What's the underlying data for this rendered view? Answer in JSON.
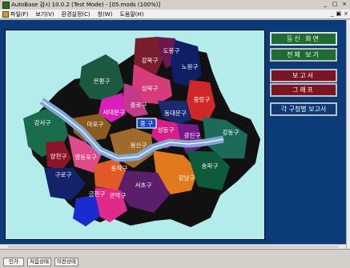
{
  "window": {
    "title": "AutoBase 감시 10.0.2 (Test Mode) - [05.mods (100%)]"
  },
  "menu": {
    "items": [
      "파일(F)",
      "보기(V)",
      "환경설정(C)",
      "창(W)",
      "도움말(H)"
    ],
    "mdi_controls": [
      "_",
      "▣",
      "×"
    ]
  },
  "window_controls": [
    "_",
    "□",
    "×"
  ],
  "map": {
    "center_label": "중 구",
    "districts": [
      {
        "id": "dobong",
        "name": "도봉구"
      },
      {
        "id": "gangbuk",
        "name": "강북구"
      },
      {
        "id": "nowon",
        "name": "노원구"
      },
      {
        "id": "eunpyeong",
        "name": "은평구"
      },
      {
        "id": "seongbuk",
        "name": "성북구"
      },
      {
        "id": "jungnang",
        "name": "중랑구"
      },
      {
        "id": "jongno",
        "name": "종로구"
      },
      {
        "id": "seodaemun",
        "name": "서대문구"
      },
      {
        "id": "dongdaemun",
        "name": "동대문구"
      },
      {
        "id": "mapo",
        "name": "마포구"
      },
      {
        "id": "seongdong",
        "name": "성동구"
      },
      {
        "id": "gwangjin",
        "name": "광진구"
      },
      {
        "id": "gangdong",
        "name": "강동구"
      },
      {
        "id": "gangseo",
        "name": "강서구"
      },
      {
        "id": "yangcheon",
        "name": "양천구"
      },
      {
        "id": "yeongdeungpo",
        "name": "영등포구"
      },
      {
        "id": "yongsan",
        "name": "용산구"
      },
      {
        "id": "dongjak",
        "name": "동작구"
      },
      {
        "id": "guro",
        "name": "구로구"
      },
      {
        "id": "gangnam",
        "name": "강남구"
      },
      {
        "id": "songpa",
        "name": "송파구"
      },
      {
        "id": "seocho",
        "name": "서초구"
      },
      {
        "id": "gwanak",
        "name": "관악구"
      },
      {
        "id": "geumcheon",
        "name": "금천구"
      }
    ]
  },
  "sidebar": {
    "buttons": [
      {
        "label": "등신 화면",
        "style": "green",
        "selected": true
      },
      {
        "label": "전체 보기",
        "style": "green",
        "selected": false
      },
      {
        "label": "보고서",
        "style": "maroon",
        "selected": false
      },
      {
        "label": "그래프",
        "style": "maroon",
        "selected": false
      },
      {
        "label": "각 구청별 보고서",
        "style": "dark",
        "selected": false
      }
    ]
  },
  "status": {
    "buttons": [
      "인가",
      "처음상태",
      "이전상태"
    ]
  },
  "colors": {
    "workspace_bg": "#0a3a78",
    "map_bg": "#b4ecec",
    "river": "#7fa8d8",
    "shadow": "#111111"
  }
}
